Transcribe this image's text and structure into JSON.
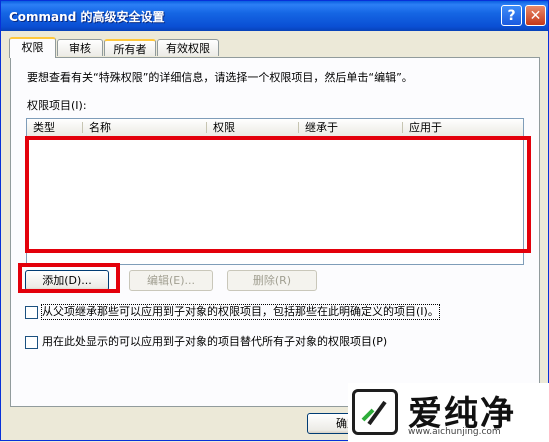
{
  "window": {
    "title": "Command 的高级安全设置",
    "help_glyph": "?",
    "close_glyph": "✕"
  },
  "tabs": [
    {
      "label": "权限",
      "active": true
    },
    {
      "label": "审核",
      "active": false
    },
    {
      "label": "所有者",
      "active": false
    },
    {
      "label": "有效权限",
      "active": false
    }
  ],
  "permissions": {
    "description": "要想查看有关“特殊权限”的详细信息，请选择一个权限项目，然后单击“编辑”。",
    "list_label": "权限项目(I):",
    "columns": [
      "类型",
      "名称",
      "权限",
      "继承于",
      "应用于"
    ],
    "rows": []
  },
  "buttons": {
    "add": "添加(D)...",
    "edit": "编辑(E)...",
    "remove": "删除(R)",
    "ok": "确定"
  },
  "options": {
    "inherit": {
      "label": "从父项继承那些可以应用到子对象的权限项目，包括那些在此明确定义的项目(I)。",
      "checked": false
    },
    "replace": {
      "label": "用在此处显示的可以应用到子对象的项目替代所有子对象的权限项目(P)",
      "checked": false
    }
  },
  "watermark": {
    "text": "爱纯净",
    "url": "www.aichunjing.com"
  },
  "colors": {
    "highlight": "#E3000B",
    "titlebar": "#0A5FE0",
    "dialog_bg": "#ECE9D8"
  }
}
